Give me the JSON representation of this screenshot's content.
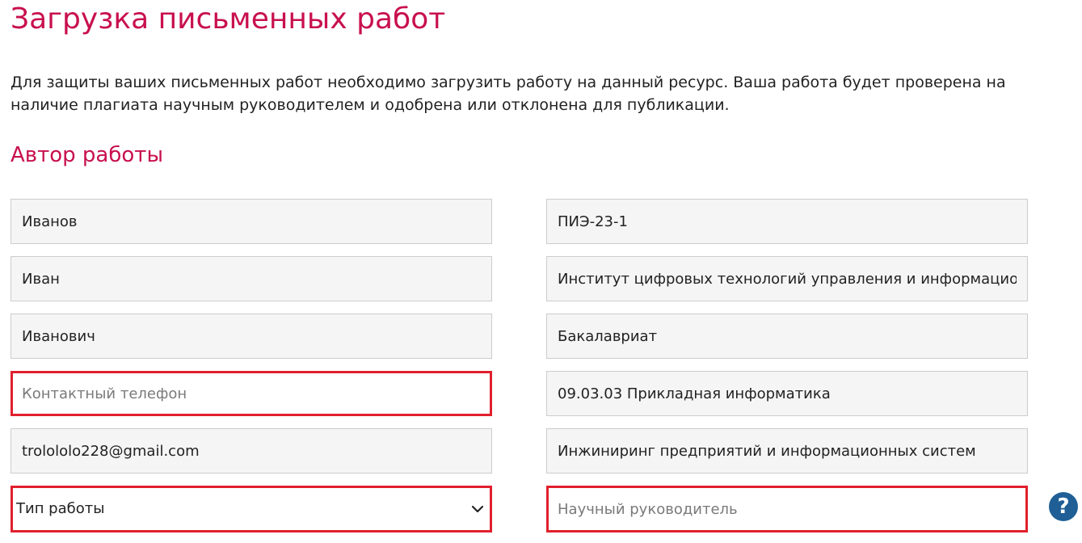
{
  "page": {
    "title": "Загрузка письменных работ",
    "intro": "Для защиты ваших письменных работ необходимо загрузить работу на данный ресурс. Ваша работа будет проверена на наличие плагиата научным руководителем и одобрена или отклонена для публикации.",
    "section_title": "Автор работы"
  },
  "form": {
    "last_name": "Иванов",
    "first_name": "Иван",
    "middle_name": "Иванович",
    "phone_placeholder": "Контактный телефон",
    "email": "trolololo228@gmail.com",
    "work_type_label": "Тип работы",
    "group": "ПИЭ-23-1",
    "institute": "Институт цифровых технологий управления и информационных систем",
    "level": "Бакалавриат",
    "direction": "09.03.03 Прикладная информатика",
    "profile": "Инжиниринг предприятий и информационных систем",
    "supervisor_placeholder": "Научный руководитель"
  },
  "help": {
    "icon": "question-mark-icon",
    "symbol": "?"
  },
  "colors": {
    "accent": "#c8104f",
    "error_border": "#e0202d",
    "help": "#1f5f96"
  }
}
